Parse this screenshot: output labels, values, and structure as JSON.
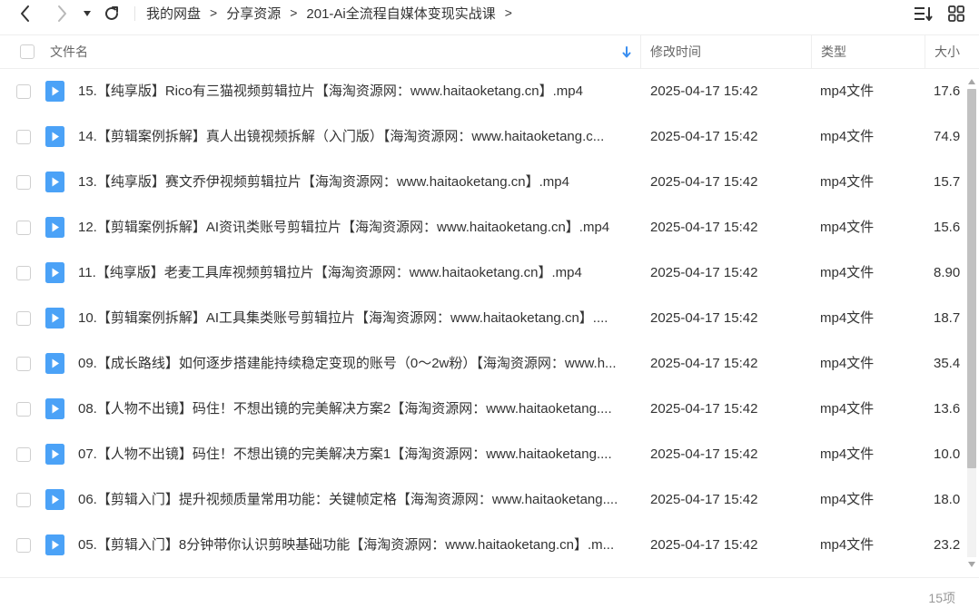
{
  "breadcrumb": {
    "items": [
      "我的网盘",
      "分享资源",
      "201-Ai全流程自媒体变现实战课"
    ],
    "separator": ">"
  },
  "columns": {
    "name": "文件名",
    "modified": "修改时间",
    "type": "类型",
    "size": "大小"
  },
  "files": [
    {
      "name": "15.【纯享版】Rico有三猫视频剪辑拉片【海淘资源网：www.haitaoketang.cn】.mp4",
      "modified": "2025-04-17 15:42",
      "type": "mp4文件",
      "size": "17.6"
    },
    {
      "name": "14.【剪辑案例拆解】真人出镜视频拆解（入门版）【海淘资源网：www.haitaoketang.c...",
      "modified": "2025-04-17 15:42",
      "type": "mp4文件",
      "size": "74.9"
    },
    {
      "name": "13.【纯享版】赛文乔伊视频剪辑拉片【海淘资源网：www.haitaoketang.cn】.mp4",
      "modified": "2025-04-17 15:42",
      "type": "mp4文件",
      "size": "15.7"
    },
    {
      "name": "12.【剪辑案例拆解】AI资讯类账号剪辑拉片【海淘资源网：www.haitaoketang.cn】.mp4",
      "modified": "2025-04-17 15:42",
      "type": "mp4文件",
      "size": "15.6"
    },
    {
      "name": "11.【纯享版】老麦工具库视频剪辑拉片【海淘资源网：www.haitaoketang.cn】.mp4",
      "modified": "2025-04-17 15:42",
      "type": "mp4文件",
      "size": "8.90"
    },
    {
      "name": "10.【剪辑案例拆解】AI工具集类账号剪辑拉片【海淘资源网：www.haitaoketang.cn】....",
      "modified": "2025-04-17 15:42",
      "type": "mp4文件",
      "size": "18.7"
    },
    {
      "name": "09.【成长路线】如何逐步搭建能持续稳定变现的账号（0～2w粉）【海淘资源网：www.h...",
      "modified": "2025-04-17 15:42",
      "type": "mp4文件",
      "size": "35.4"
    },
    {
      "name": "08.【人物不出镜】码住！不想出镜的完美解决方案2【海淘资源网：www.haitaoketang....",
      "modified": "2025-04-17 15:42",
      "type": "mp4文件",
      "size": "13.6"
    },
    {
      "name": "07.【人物不出镜】码住！不想出镜的完美解决方案1【海淘资源网：www.haitaoketang....",
      "modified": "2025-04-17 15:42",
      "type": "mp4文件",
      "size": "10.0"
    },
    {
      "name": "06.【剪辑入门】提升视频质量常用功能：关键帧定格【海淘资源网：www.haitaoketang....",
      "modified": "2025-04-17 15:42",
      "type": "mp4文件",
      "size": "18.0"
    },
    {
      "name": "05.【剪辑入门】8分钟带你认识剪映基础功能【海淘资源网：www.haitaoketang.cn】.m...",
      "modified": "2025-04-17 15:42",
      "type": "mp4文件",
      "size": "23.2"
    }
  ],
  "footer": {
    "count": "15项"
  },
  "icons": {
    "back": "chevron-left-icon",
    "forward": "chevron-right-icon",
    "history": "caret-down-icon",
    "refresh": "refresh-icon",
    "sort": "sort-icon",
    "view": "grid-view-icon",
    "file": "video-file-icon",
    "sort_direction": "arrow-down-icon"
  },
  "colors": {
    "accent": "#3a8ef0",
    "file_icon": "#4ba2f7",
    "scroll_thumb": "#c1c1c1"
  }
}
